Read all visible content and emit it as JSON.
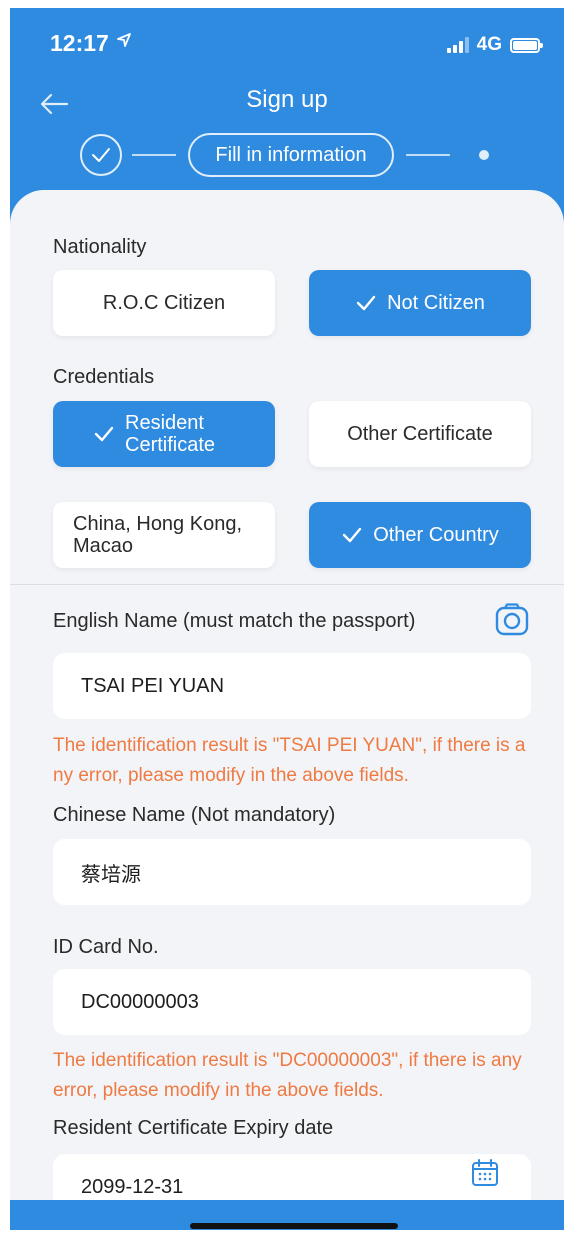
{
  "status_bar": {
    "time": "12:17",
    "network": "4G"
  },
  "header": {
    "title": "Sign up"
  },
  "stepper": {
    "current_step_label": "Fill in information"
  },
  "nationality": {
    "label": "Nationality",
    "options": [
      {
        "label": "R.O.C Citizen",
        "selected": false
      },
      {
        "label": "Not Citizen",
        "selected": true
      }
    ]
  },
  "credentials": {
    "label": "Credentials",
    "options": [
      {
        "label": "Resident Certificate",
        "selected": true
      },
      {
        "label": "Other Certificate",
        "selected": false
      },
      {
        "label": "China, Hong Kong, Macao",
        "selected": false
      },
      {
        "label": "Other Country",
        "selected": true
      }
    ]
  },
  "form": {
    "english_name": {
      "label": "English Name (must match the passport)",
      "value": "TSAI PEI YUAN",
      "hint": "The identification result is \"TSAI PEI YUAN\", if there is any error, please modify in the above fields."
    },
    "chinese_name": {
      "label": "Chinese Name (Not mandatory)",
      "value": "蔡培源"
    },
    "id_card": {
      "label": "ID Card No.",
      "value": "DC00000003",
      "hint": "The identification result is \"DC00000003\", if there is any error, please modify in the above fields."
    },
    "expiry_date": {
      "label": "Resident Certificate Expiry date",
      "value": "2099-12-31"
    }
  },
  "colors": {
    "primary": "#2f8be0",
    "card_bg": "#f3f4f8",
    "hint": "#ef7a42"
  },
  "icons": [
    "location-arrow-icon",
    "signal-icon",
    "battery-icon",
    "back-arrow-icon",
    "step-check-icon",
    "check-icon",
    "camera-icon",
    "calendar-icon"
  ]
}
